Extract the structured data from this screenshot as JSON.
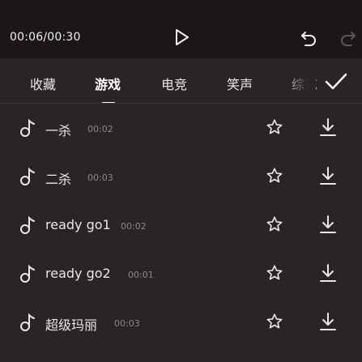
{
  "player": {
    "time": "00:06/00:30",
    "play_icon": "play-icon",
    "undo_icon": "undo-icon",
    "redo_icon": "redo-icon"
  },
  "tabs": [
    {
      "label": "收藏",
      "active": false
    },
    {
      "label": "游戏",
      "active": true
    },
    {
      "label": "电竞",
      "active": false
    },
    {
      "label": "笑声",
      "active": false
    },
    {
      "label": "综艺",
      "active": false
    }
  ],
  "confirm_icon": "check-icon",
  "sounds": [
    {
      "name": "一杀",
      "duration": "00:02"
    },
    {
      "name": "二杀",
      "duration": "00:03"
    },
    {
      "name": "ready go1",
      "duration": "00:02"
    },
    {
      "name": "ready go2",
      "duration": "00:01"
    },
    {
      "name": "超级玛丽",
      "duration": "00:03"
    }
  ],
  "colors": {
    "topbar_bg": "#1a1619",
    "panel_bg": "#2a2428",
    "text": "#e8e8e8",
    "muted": "#8d878b"
  }
}
